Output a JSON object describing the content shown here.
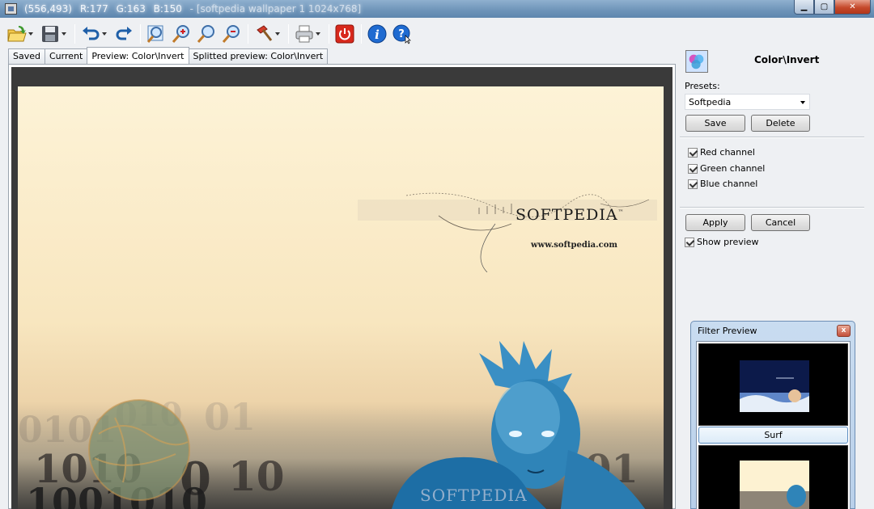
{
  "window": {
    "coords": "(556,493)",
    "r": "R:177",
    "g": "G:163",
    "b": "B:150",
    "filename": "- [softpedia wallpaper 1 1024x768]"
  },
  "toolbar": {
    "items": [
      "open-icon",
      "save-icon",
      "undo-icon",
      "redo-icon",
      "zoom-fit-icon",
      "zoom-in-icon",
      "zoom-icon",
      "zoom-out-icon",
      "filter-hammer-icon",
      "print-icon",
      "power-icon",
      "info-icon",
      "help-icon"
    ]
  },
  "tabs": [
    "Saved",
    "Current",
    "Preview: Color\\Invert",
    "Splitted preview: Color\\Invert"
  ],
  "preview": {
    "logo": "SOFTPEDIA",
    "tm": "™",
    "url": "www.softpedia.com",
    "watermark": "SOFTPEDIA"
  },
  "panel": {
    "filter_title": "Color\\Invert",
    "presets_label": "Presets:",
    "preset_value": "Softpedia",
    "save_label": "Save",
    "delete_label": "Delete",
    "red_channel": "Red channel",
    "green_channel": "Green channel",
    "blue_channel": "Blue channel",
    "apply_label": "Apply",
    "cancel_label": "Cancel",
    "show_preview": "Show preview"
  },
  "filter_preview": {
    "title": "Filter Preview",
    "close": "x",
    "items": [
      "Surf"
    ]
  },
  "colors": {
    "titlebar": "#6d93b8",
    "wallpaper_bg": "#fdf3d7",
    "inverted_figure": "#2f84b8"
  }
}
